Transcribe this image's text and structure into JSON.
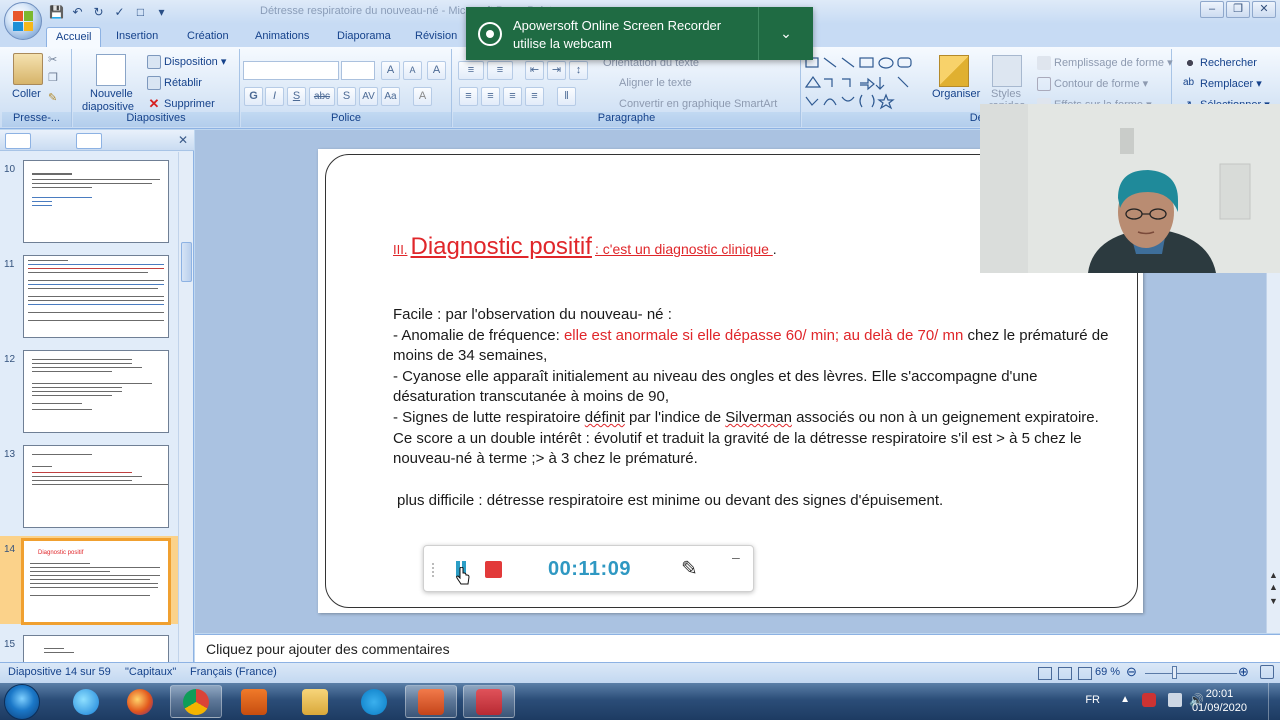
{
  "quick_access": {
    "icons": [
      "save-icon",
      "undo-icon",
      "redo-icon",
      "spellcheck-icon",
      "new-slide-icon",
      "customize-icon"
    ]
  },
  "window_title": "Détresse respiratoire du nouveau-né - Microsoft PowerPoint",
  "tabs": [
    "Accueil",
    "Insertion",
    "Création",
    "Animations",
    "Diaporama",
    "Révision"
  ],
  "ribbon": {
    "clipboard": {
      "paste": "Coller",
      "title": "Presse-..."
    },
    "slides": {
      "new_slide_l1": "Nouvelle",
      "new_slide_l2": "diapositive",
      "layout": "Disposition",
      "reset": "Rétablir",
      "delete": "Supprimer",
      "title": "Diapositives"
    },
    "font": {
      "title": "Police",
      "bold": "G",
      "italic": "I",
      "underline": "S",
      "strike": "abc",
      "shadow": "S",
      "grow": "A",
      "shrink": "A",
      "clear": "A"
    },
    "paragraph": {
      "text_direction": "Orientation du texte",
      "align_text": "Aligner le texte",
      "smartart": "Convertir en graphique SmartArt",
      "title": "Paragraphe"
    },
    "drawing": {
      "arrange": "Organiser",
      "styles_l1": "Styles",
      "styles_l2": "rapides",
      "fill": "Remplissage de forme",
      "outline": "Contour de forme",
      "effects": "Effets sur la forme",
      "title": "Dessin"
    },
    "editing": {
      "find": "Rechercher",
      "replace": "Remplacer",
      "select": "Sélectionner"
    }
  },
  "notification": {
    "line1": "Apowersoft Online Screen Recorder",
    "line2": "utilise la webcam"
  },
  "slide_panel": {
    "slides": [
      {
        "number": "10"
      },
      {
        "number": "11"
      },
      {
        "number": "12"
      },
      {
        "number": "13"
      },
      {
        "number": "14",
        "selected": true,
        "title": "Diagnostic positif"
      },
      {
        "number": "15"
      }
    ]
  },
  "slide": {
    "title_roman": "III.",
    "title_main": "Diagnostic positif",
    "title_sub": " : c'est un diagnostic clinique ",
    "title_end": ".",
    "p1": "Facile :  par l'observation du nouveau- né :",
    "p2_a": "- Anomalie de fréquence: ",
    "p2_red": "elle est anormale si elle dépasse 60/ min; au delà de 70/ mn",
    "p2_b": " chez le prématuré de moins de 34 semaines,",
    "p3": "- Cyanose elle apparaît initialement au niveau des ongles et des lèvres. Elle s'accompagne d'une désaturation transcutanée à moins de 90,",
    "p4_a": "- Signes de lutte respiratoire ",
    "p4_sq1": "définit",
    "p4_b": " par l'indice de ",
    "p4_sq2": "Silverman",
    "p4_c": " associés ou non à un geignement expiratoire. Ce score a un double intérêt : évolutif et traduit la gravité de la détresse respiratoire s'il est > à 5 chez le nouveau-né à terme  ;> à 3 chez le prématuré.",
    "p5": "plus difficile :  détresse respiratoire est minime ou  devant des signes d'épuisement."
  },
  "recorder": {
    "time": "00:11:09",
    "minimize": "–"
  },
  "notes": {
    "placeholder": "Cliquez pour ajouter des commentaires"
  },
  "status": {
    "slide_info": "Diapositive 14 sur 59",
    "theme": "\"Capitaux\"",
    "language": "Français (France)",
    "zoom": "69 %"
  },
  "taskbar": {
    "apps": [
      "internet-explorer",
      "firefox",
      "chrome",
      "media-player",
      "file-explorer",
      "skype",
      "powerpoint",
      "screen-recorder"
    ],
    "lang": "FR",
    "time": "20:01",
    "date": "01/09/2020"
  },
  "colors": {
    "accent_red": "#e0262a",
    "timer_blue": "#2f98c2",
    "notify_green": "#1f6b43",
    "selected_slide": "#f0a030"
  }
}
